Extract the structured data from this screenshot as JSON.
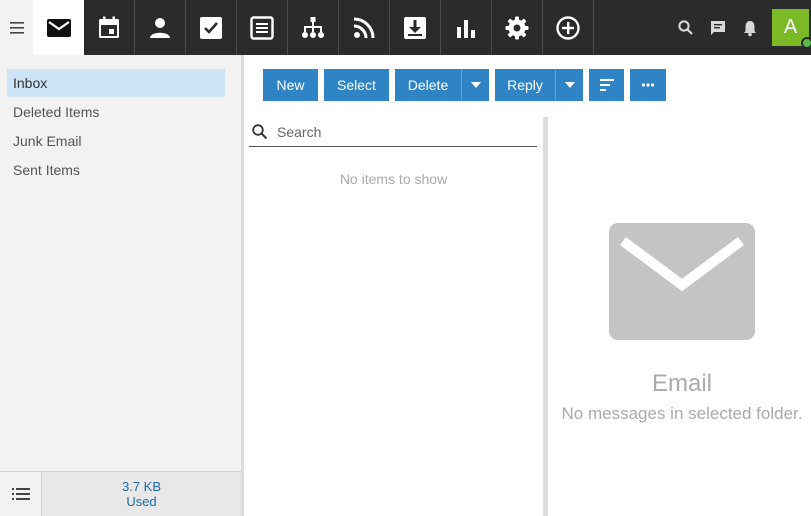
{
  "colors": {
    "topbar": "#2b2b2b",
    "accent": "#2f84c6",
    "selected_folder": "#cce4f5",
    "avatar": "#7cb927",
    "presence": "#57b947"
  },
  "topbar": {
    "menu_icon": "hamburger-icon",
    "apps": [
      {
        "name": "mail",
        "icon": "mail-icon",
        "active": true
      },
      {
        "name": "calendar",
        "icon": "calendar-icon",
        "active": false
      },
      {
        "name": "contacts",
        "icon": "person-icon",
        "active": false
      },
      {
        "name": "tasks",
        "icon": "checkbox-icon",
        "active": false
      },
      {
        "name": "notes",
        "icon": "notes-icon",
        "active": false
      },
      {
        "name": "organization",
        "icon": "org-chart-icon",
        "active": false
      },
      {
        "name": "feeds",
        "icon": "rss-icon",
        "active": false
      },
      {
        "name": "files",
        "icon": "download-box-icon",
        "active": false
      },
      {
        "name": "reports",
        "icon": "bar-chart-icon",
        "active": false
      },
      {
        "name": "settings",
        "icon": "gear-icon",
        "active": false
      },
      {
        "name": "add",
        "icon": "plus-circle-icon",
        "active": false
      }
    ],
    "right_icons": [
      "search-icon",
      "chat-icon",
      "bell-icon"
    ],
    "avatar_letter": "A"
  },
  "sidebar": {
    "folders": [
      {
        "label": "Inbox",
        "selected": true
      },
      {
        "label": "Deleted Items",
        "selected": false
      },
      {
        "label": "Junk Email",
        "selected": false
      },
      {
        "label": "Sent Items",
        "selected": false
      }
    ],
    "footer": {
      "usage_size": "3.7 KB",
      "usage_label": "Used"
    }
  },
  "toolbar": {
    "new_label": "New",
    "select_label": "Select",
    "delete_label": "Delete",
    "reply_label": "Reply",
    "sort_icon": "sort-icon",
    "more_icon": "more-dots-icon"
  },
  "list": {
    "search_placeholder": "Search",
    "empty_text": "No items to show"
  },
  "reading": {
    "title": "Email",
    "subtitle": "No messages in selected folder."
  }
}
